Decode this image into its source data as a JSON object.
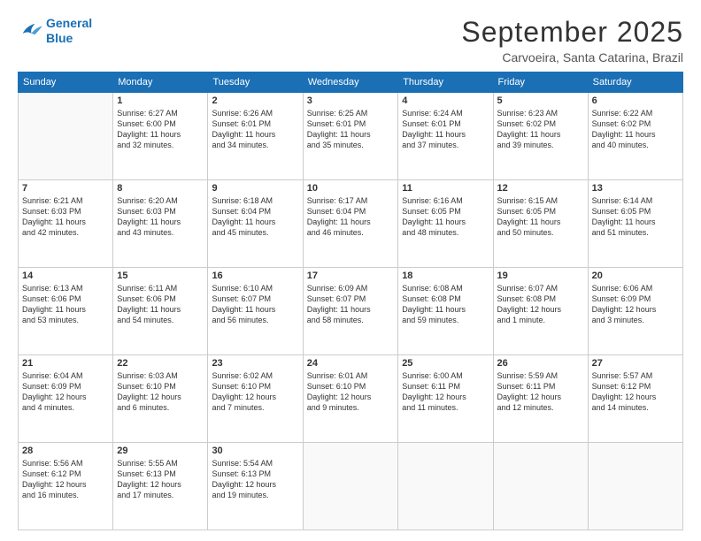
{
  "logo": {
    "line1": "General",
    "line2": "Blue"
  },
  "title": "September 2025",
  "subtitle": "Carvoeira, Santa Catarina, Brazil",
  "headers": [
    "Sunday",
    "Monday",
    "Tuesday",
    "Wednesday",
    "Thursday",
    "Friday",
    "Saturday"
  ],
  "weeks": [
    [
      {
        "day": "",
        "info": ""
      },
      {
        "day": "1",
        "info": "Sunrise: 6:27 AM\nSunset: 6:00 PM\nDaylight: 11 hours\nand 32 minutes."
      },
      {
        "day": "2",
        "info": "Sunrise: 6:26 AM\nSunset: 6:01 PM\nDaylight: 11 hours\nand 34 minutes."
      },
      {
        "day": "3",
        "info": "Sunrise: 6:25 AM\nSunset: 6:01 PM\nDaylight: 11 hours\nand 35 minutes."
      },
      {
        "day": "4",
        "info": "Sunrise: 6:24 AM\nSunset: 6:01 PM\nDaylight: 11 hours\nand 37 minutes."
      },
      {
        "day": "5",
        "info": "Sunrise: 6:23 AM\nSunset: 6:02 PM\nDaylight: 11 hours\nand 39 minutes."
      },
      {
        "day": "6",
        "info": "Sunrise: 6:22 AM\nSunset: 6:02 PM\nDaylight: 11 hours\nand 40 minutes."
      }
    ],
    [
      {
        "day": "7",
        "info": "Sunrise: 6:21 AM\nSunset: 6:03 PM\nDaylight: 11 hours\nand 42 minutes."
      },
      {
        "day": "8",
        "info": "Sunrise: 6:20 AM\nSunset: 6:03 PM\nDaylight: 11 hours\nand 43 minutes."
      },
      {
        "day": "9",
        "info": "Sunrise: 6:18 AM\nSunset: 6:04 PM\nDaylight: 11 hours\nand 45 minutes."
      },
      {
        "day": "10",
        "info": "Sunrise: 6:17 AM\nSunset: 6:04 PM\nDaylight: 11 hours\nand 46 minutes."
      },
      {
        "day": "11",
        "info": "Sunrise: 6:16 AM\nSunset: 6:05 PM\nDaylight: 11 hours\nand 48 minutes."
      },
      {
        "day": "12",
        "info": "Sunrise: 6:15 AM\nSunset: 6:05 PM\nDaylight: 11 hours\nand 50 minutes."
      },
      {
        "day": "13",
        "info": "Sunrise: 6:14 AM\nSunset: 6:05 PM\nDaylight: 11 hours\nand 51 minutes."
      }
    ],
    [
      {
        "day": "14",
        "info": "Sunrise: 6:13 AM\nSunset: 6:06 PM\nDaylight: 11 hours\nand 53 minutes."
      },
      {
        "day": "15",
        "info": "Sunrise: 6:11 AM\nSunset: 6:06 PM\nDaylight: 11 hours\nand 54 minutes."
      },
      {
        "day": "16",
        "info": "Sunrise: 6:10 AM\nSunset: 6:07 PM\nDaylight: 11 hours\nand 56 minutes."
      },
      {
        "day": "17",
        "info": "Sunrise: 6:09 AM\nSunset: 6:07 PM\nDaylight: 11 hours\nand 58 minutes."
      },
      {
        "day": "18",
        "info": "Sunrise: 6:08 AM\nSunset: 6:08 PM\nDaylight: 11 hours\nand 59 minutes."
      },
      {
        "day": "19",
        "info": "Sunrise: 6:07 AM\nSunset: 6:08 PM\nDaylight: 12 hours\nand 1 minute."
      },
      {
        "day": "20",
        "info": "Sunrise: 6:06 AM\nSunset: 6:09 PM\nDaylight: 12 hours\nand 3 minutes."
      }
    ],
    [
      {
        "day": "21",
        "info": "Sunrise: 6:04 AM\nSunset: 6:09 PM\nDaylight: 12 hours\nand 4 minutes."
      },
      {
        "day": "22",
        "info": "Sunrise: 6:03 AM\nSunset: 6:10 PM\nDaylight: 12 hours\nand 6 minutes."
      },
      {
        "day": "23",
        "info": "Sunrise: 6:02 AM\nSunset: 6:10 PM\nDaylight: 12 hours\nand 7 minutes."
      },
      {
        "day": "24",
        "info": "Sunrise: 6:01 AM\nSunset: 6:10 PM\nDaylight: 12 hours\nand 9 minutes."
      },
      {
        "day": "25",
        "info": "Sunrise: 6:00 AM\nSunset: 6:11 PM\nDaylight: 12 hours\nand 11 minutes."
      },
      {
        "day": "26",
        "info": "Sunrise: 5:59 AM\nSunset: 6:11 PM\nDaylight: 12 hours\nand 12 minutes."
      },
      {
        "day": "27",
        "info": "Sunrise: 5:57 AM\nSunset: 6:12 PM\nDaylight: 12 hours\nand 14 minutes."
      }
    ],
    [
      {
        "day": "28",
        "info": "Sunrise: 5:56 AM\nSunset: 6:12 PM\nDaylight: 12 hours\nand 16 minutes."
      },
      {
        "day": "29",
        "info": "Sunrise: 5:55 AM\nSunset: 6:13 PM\nDaylight: 12 hours\nand 17 minutes."
      },
      {
        "day": "30",
        "info": "Sunrise: 5:54 AM\nSunset: 6:13 PM\nDaylight: 12 hours\nand 19 minutes."
      },
      {
        "day": "",
        "info": ""
      },
      {
        "day": "",
        "info": ""
      },
      {
        "day": "",
        "info": ""
      },
      {
        "day": "",
        "info": ""
      }
    ]
  ]
}
